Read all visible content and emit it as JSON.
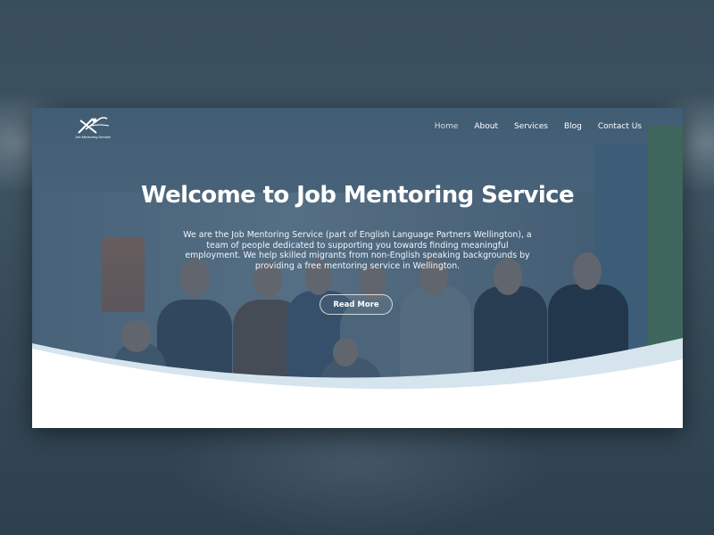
{
  "logo": {
    "icon": "person-star-logo-icon",
    "text": "Job Mentoring Service"
  },
  "nav": {
    "items": [
      {
        "label": "Home",
        "active": true
      },
      {
        "label": "About",
        "active": false
      },
      {
        "label": "Services",
        "active": false
      },
      {
        "label": "Blog",
        "active": false
      },
      {
        "label": "Contact Us",
        "active": false
      }
    ]
  },
  "hero": {
    "title": "Welcome to Job Mentoring Service",
    "description": "We are the Job Mentoring Service (part of English Language Partners Wellington), a team of people dedicated to supporting you towards finding meaningful employment. We help skilled migrants from non-English speaking backgrounds by providing a free mentoring service in Wellington.",
    "cta_label": "Read More"
  },
  "colors": {
    "overlay": "#264660",
    "wave_light": "#d9e6ef",
    "text": "#ffffff"
  }
}
